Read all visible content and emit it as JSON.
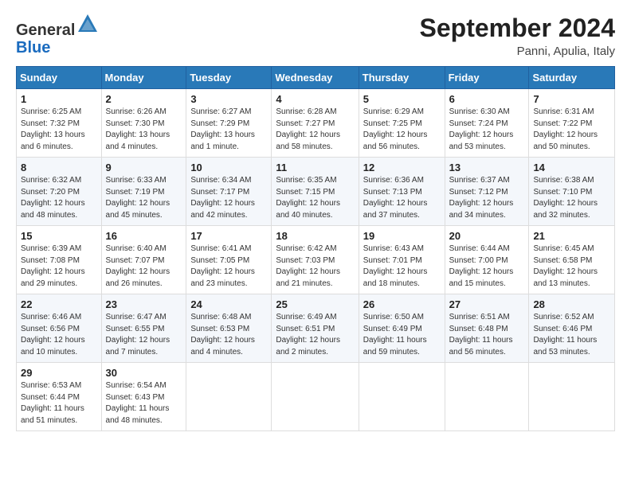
{
  "header": {
    "logo_general": "General",
    "logo_blue": "Blue",
    "month_title": "September 2024",
    "location": "Panni, Apulia, Italy"
  },
  "weekdays": [
    "Sunday",
    "Monday",
    "Tuesday",
    "Wednesday",
    "Thursday",
    "Friday",
    "Saturday"
  ],
  "weeks": [
    [
      {
        "day": "1",
        "sunrise": "6:25 AM",
        "sunset": "7:32 PM",
        "daylight": "13 hours and 6 minutes."
      },
      {
        "day": "2",
        "sunrise": "6:26 AM",
        "sunset": "7:30 PM",
        "daylight": "13 hours and 4 minutes."
      },
      {
        "day": "3",
        "sunrise": "6:27 AM",
        "sunset": "7:29 PM",
        "daylight": "13 hours and 1 minute."
      },
      {
        "day": "4",
        "sunrise": "6:28 AM",
        "sunset": "7:27 PM",
        "daylight": "12 hours and 58 minutes."
      },
      {
        "day": "5",
        "sunrise": "6:29 AM",
        "sunset": "7:25 PM",
        "daylight": "12 hours and 56 minutes."
      },
      {
        "day": "6",
        "sunrise": "6:30 AM",
        "sunset": "7:24 PM",
        "daylight": "12 hours and 53 minutes."
      },
      {
        "day": "7",
        "sunrise": "6:31 AM",
        "sunset": "7:22 PM",
        "daylight": "12 hours and 50 minutes."
      }
    ],
    [
      {
        "day": "8",
        "sunrise": "6:32 AM",
        "sunset": "7:20 PM",
        "daylight": "12 hours and 48 minutes."
      },
      {
        "day": "9",
        "sunrise": "6:33 AM",
        "sunset": "7:19 PM",
        "daylight": "12 hours and 45 minutes."
      },
      {
        "day": "10",
        "sunrise": "6:34 AM",
        "sunset": "7:17 PM",
        "daylight": "12 hours and 42 minutes."
      },
      {
        "day": "11",
        "sunrise": "6:35 AM",
        "sunset": "7:15 PM",
        "daylight": "12 hours and 40 minutes."
      },
      {
        "day": "12",
        "sunrise": "6:36 AM",
        "sunset": "7:13 PM",
        "daylight": "12 hours and 37 minutes."
      },
      {
        "day": "13",
        "sunrise": "6:37 AM",
        "sunset": "7:12 PM",
        "daylight": "12 hours and 34 minutes."
      },
      {
        "day": "14",
        "sunrise": "6:38 AM",
        "sunset": "7:10 PM",
        "daylight": "12 hours and 32 minutes."
      }
    ],
    [
      {
        "day": "15",
        "sunrise": "6:39 AM",
        "sunset": "7:08 PM",
        "daylight": "12 hours and 29 minutes."
      },
      {
        "day": "16",
        "sunrise": "6:40 AM",
        "sunset": "7:07 PM",
        "daylight": "12 hours and 26 minutes."
      },
      {
        "day": "17",
        "sunrise": "6:41 AM",
        "sunset": "7:05 PM",
        "daylight": "12 hours and 23 minutes."
      },
      {
        "day": "18",
        "sunrise": "6:42 AM",
        "sunset": "7:03 PM",
        "daylight": "12 hours and 21 minutes."
      },
      {
        "day": "19",
        "sunrise": "6:43 AM",
        "sunset": "7:01 PM",
        "daylight": "12 hours and 18 minutes."
      },
      {
        "day": "20",
        "sunrise": "6:44 AM",
        "sunset": "7:00 PM",
        "daylight": "12 hours and 15 minutes."
      },
      {
        "day": "21",
        "sunrise": "6:45 AM",
        "sunset": "6:58 PM",
        "daylight": "12 hours and 13 minutes."
      }
    ],
    [
      {
        "day": "22",
        "sunrise": "6:46 AM",
        "sunset": "6:56 PM",
        "daylight": "12 hours and 10 minutes."
      },
      {
        "day": "23",
        "sunrise": "6:47 AM",
        "sunset": "6:55 PM",
        "daylight": "12 hours and 7 minutes."
      },
      {
        "day": "24",
        "sunrise": "6:48 AM",
        "sunset": "6:53 PM",
        "daylight": "12 hours and 4 minutes."
      },
      {
        "day": "25",
        "sunrise": "6:49 AM",
        "sunset": "6:51 PM",
        "daylight": "12 hours and 2 minutes."
      },
      {
        "day": "26",
        "sunrise": "6:50 AM",
        "sunset": "6:49 PM",
        "daylight": "11 hours and 59 minutes."
      },
      {
        "day": "27",
        "sunrise": "6:51 AM",
        "sunset": "6:48 PM",
        "daylight": "11 hours and 56 minutes."
      },
      {
        "day": "28",
        "sunrise": "6:52 AM",
        "sunset": "6:46 PM",
        "daylight": "11 hours and 53 minutes."
      }
    ],
    [
      {
        "day": "29",
        "sunrise": "6:53 AM",
        "sunset": "6:44 PM",
        "daylight": "11 hours and 51 minutes."
      },
      {
        "day": "30",
        "sunrise": "6:54 AM",
        "sunset": "6:43 PM",
        "daylight": "11 hours and 48 minutes."
      },
      null,
      null,
      null,
      null,
      null
    ]
  ]
}
